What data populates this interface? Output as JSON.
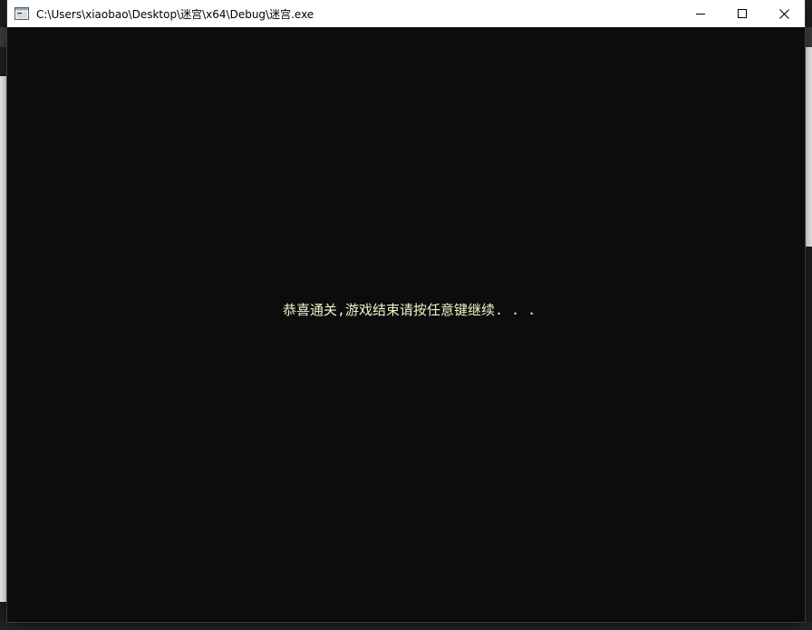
{
  "window": {
    "title": "C:\\Users\\xiaobao\\Desktop\\迷宫\\x64\\Debug\\迷宫.exe",
    "icon": "console-app-icon",
    "controls": {
      "minimize_icon": "minimize-icon",
      "maximize_icon": "maximize-icon",
      "close_icon": "close-icon"
    }
  },
  "console": {
    "background": "#0c0c0c",
    "text_color": "#f2f2c8",
    "message": "恭喜通关,游戏结束请按任意键继续. . ."
  }
}
